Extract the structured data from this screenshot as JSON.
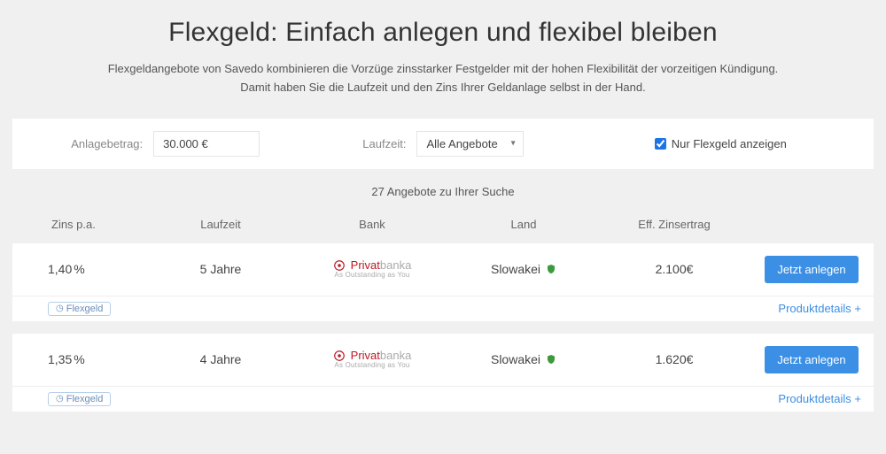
{
  "header": {
    "title": "Flexgeld: Einfach anlegen und flexibel bleiben",
    "intro_line1": "Flexgeldangebote von Savedo kombinieren die Vorzüge zinsstarker Festgelder mit der hohen Flexibilität der vorzeitigen Kündigung.",
    "intro_line2": "Damit haben Sie die Laufzeit und den Zins Ihrer Geldanlage selbst in der Hand."
  },
  "filter": {
    "amount_label": "Anlagebetrag:",
    "amount_value": "30.000 €",
    "term_label": "Laufzeit:",
    "term_value": "Alle Angebote",
    "flex_only_label": "Nur Flexgeld anzeigen",
    "flex_only_checked": true
  },
  "results_line": "27 Angebote zu Ihrer Suche",
  "columns": {
    "zins": "Zins p.a.",
    "laufzeit": "Laufzeit",
    "bank": "Bank",
    "land": "Land",
    "ertrag": "Eff. Zinsertrag"
  },
  "rows": [
    {
      "zins_num": "1,40",
      "zins_unit": "%",
      "laufzeit": "5 Jahre",
      "bank_name_red": "Privat",
      "bank_name_grey": "banka",
      "bank_sub": "As Outstanding as You",
      "land": "Slowakei",
      "ertrag": "2.100€",
      "cta": "Jetzt anlegen",
      "pill": "Flexgeld",
      "details": "Produktdetails +"
    },
    {
      "zins_num": "1,35",
      "zins_unit": "%",
      "laufzeit": "4 Jahre",
      "bank_name_red": "Privat",
      "bank_name_grey": "banka",
      "bank_sub": "As Outstanding as You",
      "land": "Slowakei",
      "ertrag": "1.620€",
      "cta": "Jetzt anlegen",
      "pill": "Flexgeld",
      "details": "Produktdetails +"
    }
  ]
}
